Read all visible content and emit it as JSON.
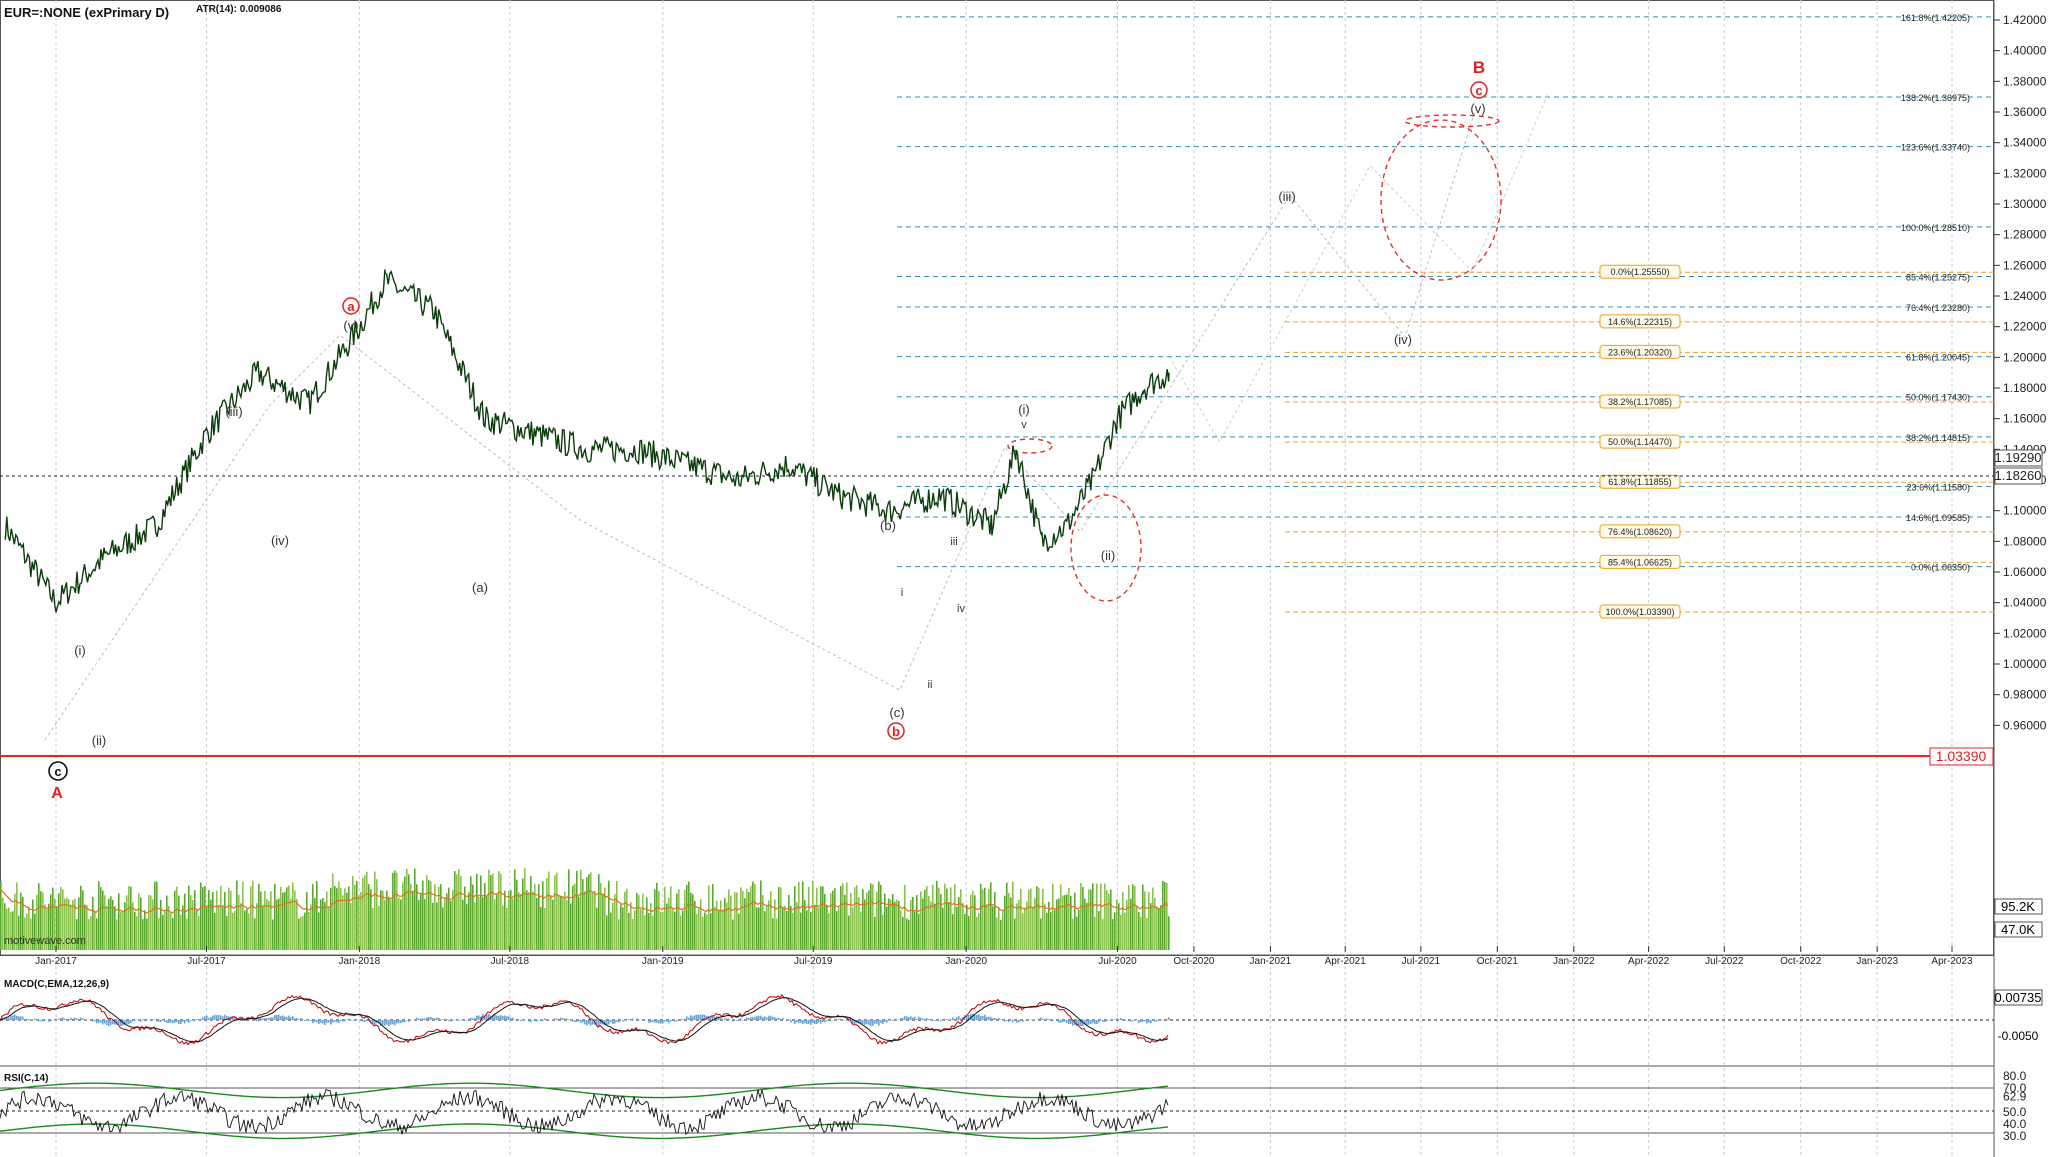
{
  "main_panel": {
    "title": "EUR=:NONE (exPrimary D)",
    "indicator": "ATR(14): 0.009086",
    "watermark": "motivewave.com",
    "price_ticks": [
      "1.42000",
      "1.40000",
      "1.38000",
      "1.36000",
      "1.34000",
      "1.32000",
      "1.30000",
      "1.28000",
      "1.26000",
      "1.24000",
      "1.22000",
      "1.20000",
      "1.18000",
      "1.16000",
      "1.14000",
      "1.12000",
      "1.10000",
      "1.08000",
      "1.06000",
      "1.04000",
      "1.02000",
      "1.00000",
      "0.98000",
      "0.96000"
    ],
    "current_price_label": "1.19290",
    "crosshair_price_label": "1.18260",
    "support_price_label": "1.03390",
    "volume_labels": [
      "95.2K",
      "47.0K"
    ]
  },
  "time_axis": {
    "labels": [
      "Jan-2017",
      "Jul-2017",
      "Jan-2018",
      "Jul-2018",
      "Jan-2019",
      "Jul-2019",
      "Jan-2020",
      "Jul-2020",
      "Oct-2020",
      "Jan-2021",
      "Apr-2021",
      "Jul-2021",
      "Oct-2021",
      "Jan-2022",
      "Apr-2022",
      "Jul-2022",
      "Oct-2022",
      "Jan-2023",
      "Apr-2023"
    ]
  },
  "fib_blue": [
    {
      "label": "161.8%(1.42205)",
      "value": 1.42205
    },
    {
      "label": "138.2%(1.36975)",
      "value": 1.36975
    },
    {
      "label": "123.6%(1.33740)",
      "value": 1.3374
    },
    {
      "label": "100.0%(1.28510)",
      "value": 1.2851
    },
    {
      "label": "85.4%(1.25275)",
      "value": 1.25275
    },
    {
      "label": "76.4%(1.23280)",
      "value": 1.2328
    },
    {
      "label": "61.8%(1.20045)",
      "value": 1.20045
    },
    {
      "label": "50.0%(1.17430)",
      "value": 1.1743
    },
    {
      "label": "38.2%(1.14815)",
      "value": 1.14815
    },
    {
      "label": "23.6%(1.11580)",
      "value": 1.1158
    },
    {
      "label": "14.6%(1.09585)",
      "value": 1.09585
    },
    {
      "label": "0.0%(1.06350)",
      "value": 1.0635
    }
  ],
  "fib_orange": [
    {
      "label": "0.0%(1.25550)",
      "value": 1.2555
    },
    {
      "label": "14.6%(1.22315)",
      "value": 1.22315
    },
    {
      "label": "23.6%(1.20320)",
      "value": 1.2032
    },
    {
      "label": "38.2%(1.17085)",
      "value": 1.17085
    },
    {
      "label": "50.0%(1.14470)",
      "value": 1.1447
    },
    {
      "label": "61.8%(1.11855)",
      "value": 1.11855
    },
    {
      "label": "76.4%(1.08620)",
      "value": 1.0862
    },
    {
      "label": "85.4%(1.06625)",
      "value": 1.06625
    },
    {
      "label": "100.0%(1.03390)",
      "value": 1.0339
    }
  ],
  "wave_labels": {
    "red_a": "a",
    "red_b": "b",
    "red_c": "c",
    "red_A": "A",
    "red_B": "B",
    "black_c": "c",
    "v_top": "(v)",
    "iii": "(iii)",
    "iv": "(iv)",
    "i": "(i)",
    "ii": "(ii)",
    "a_paren": "(a)",
    "b_paren": "(b)",
    "c_paren": "(c)",
    "s_i": "i",
    "s_ii": "ii",
    "s_iii": "iii",
    "s_iv": "iv",
    "s_v": "v",
    "proj_i": "(i)",
    "proj_ii": "(ii)",
    "proj_iii": "(iii)",
    "proj_iv": "(iv)",
    "proj_v": "(v)"
  },
  "macd": {
    "title": "MACD(C,EMA,12,26,9)",
    "value_label": "0.00735",
    "tick_label": "-0.0050"
  },
  "rsi": {
    "title": "RSI(C,14)",
    "ticks": [
      "80.0",
      "70.0",
      "62.9",
      "50.0",
      "40.0",
      "30.0"
    ]
  },
  "chart_data": {
    "type": "line",
    "title": "EUR=:NONE (exPrimary D)",
    "xlabel": "",
    "ylabel": "",
    "ylim": [
      0.95,
      1.43
    ],
    "x": [
      "2016-11",
      "2017-01",
      "2017-03",
      "2017-05",
      "2017-07",
      "2017-09",
      "2017-11",
      "2018-01",
      "2018-02",
      "2018-04",
      "2018-06",
      "2018-08",
      "2018-10",
      "2018-12",
      "2019-02",
      "2019-04",
      "2019-06",
      "2019-08",
      "2019-10",
      "2019-12",
      "2020-02",
      "2020-03",
      "2020-04",
      "2020-05",
      "2020-06",
      "2020-07",
      "2020-08",
      "2020-09"
    ],
    "series": [
      {
        "values": [
          1.09,
          1.04,
          1.07,
          1.09,
          1.15,
          1.19,
          1.17,
          1.22,
          1.25,
          1.23,
          1.16,
          1.15,
          1.14,
          1.14,
          1.13,
          1.12,
          1.13,
          1.11,
          1.1,
          1.11,
          1.09,
          1.14,
          1.08,
          1.09,
          1.12,
          1.16,
          1.18,
          1.19
        ]
      }
    ],
    "projection": {
      "x": [
        "2020-09",
        "2020-11",
        "2021-05",
        "2021-09",
        "2021-12"
      ],
      "values": [
        1.2005,
        1.145,
        1.325,
        1.256,
        1.372
      ]
    }
  }
}
